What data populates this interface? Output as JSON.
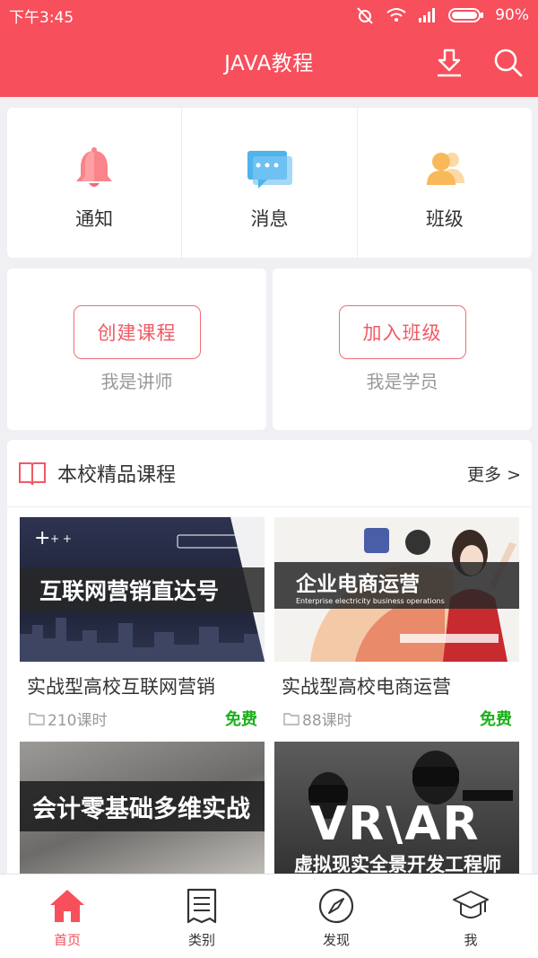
{
  "status_bar": {
    "time": "下午3:45",
    "battery": "90%",
    "network": "3G 1X"
  },
  "header": {
    "title": "JAVA教程"
  },
  "quick_actions": [
    {
      "label": "通知",
      "icon": "bell-icon"
    },
    {
      "label": "消息",
      "icon": "chat-icon"
    },
    {
      "label": "班级",
      "icon": "users-icon"
    }
  ],
  "roles": [
    {
      "button": "创建课程",
      "subtitle": "我是讲师"
    },
    {
      "button": "加入班级",
      "subtitle": "我是学员"
    }
  ],
  "courses_section": {
    "title": "本校精品课程",
    "more": "更多 >",
    "courses": [
      {
        "title": "实战型高校互联网营销",
        "hours": "210课时",
        "price": "免费",
        "thumb_text": "互联网营销直达号"
      },
      {
        "title": "实战型高校电商运营",
        "hours": "88课时",
        "price": "免费",
        "thumb_text": "企业电商运营",
        "thumb_subtext": "Enterprise electricity business operations"
      },
      {
        "thumb_text": "会计零基础多维实战"
      },
      {
        "thumb_text": "VR\\AR",
        "thumb_subtext": "虚拟现实全景开发工程师"
      }
    ]
  },
  "tabbar": [
    {
      "label": "首页",
      "icon": "home-icon",
      "active": true
    },
    {
      "label": "类别",
      "icon": "list-icon"
    },
    {
      "label": "发现",
      "icon": "compass-icon"
    },
    {
      "label": "我",
      "icon": "graduation-cap-icon"
    }
  ],
  "colors": {
    "brand": "#f74f5b",
    "free": "#1bb01b",
    "muted": "#999999"
  }
}
